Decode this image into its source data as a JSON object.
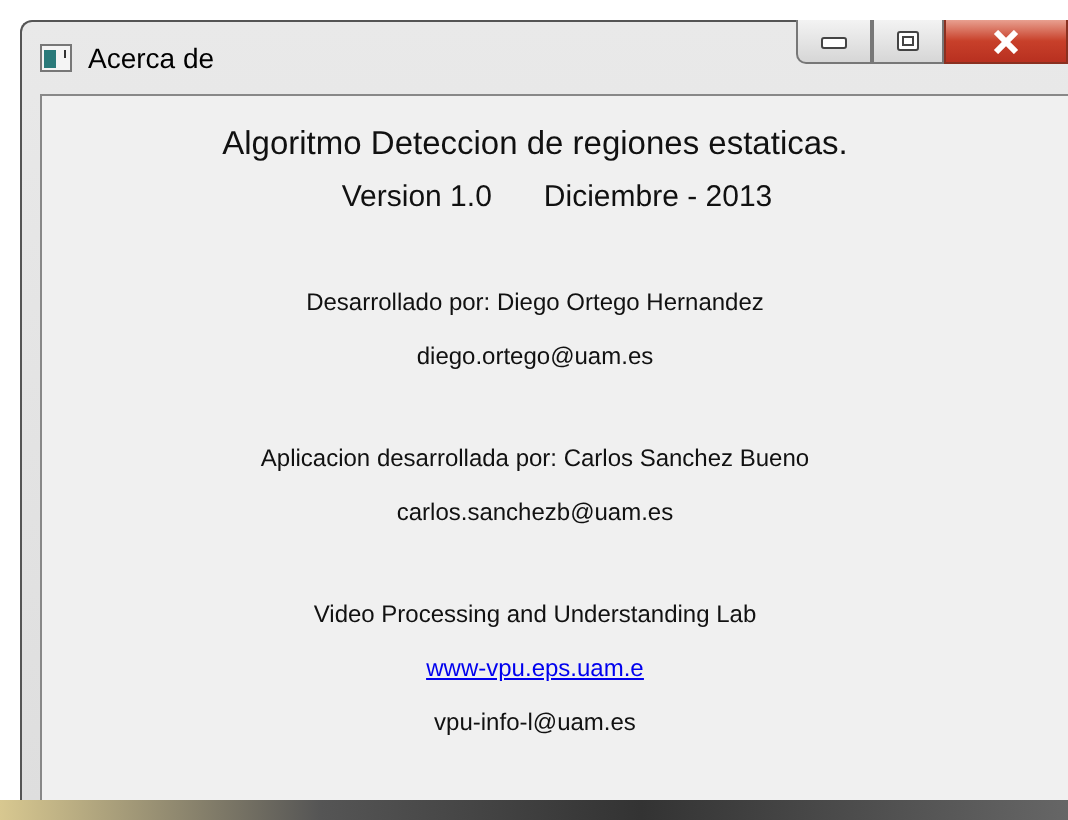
{
  "window": {
    "title": "Acerca de",
    "controls": [
      {
        "kind": "minimize"
      },
      {
        "kind": "maximize"
      },
      {
        "kind": "close"
      }
    ]
  },
  "sections": [
    {
      "lines": [
        {
          "kind": "heading",
          "parts": [
            "Algoritmo Deteccion de regiones estaticas."
          ]
        },
        {
          "kind": "subheading",
          "parts": [
            "Version 1.0",
            "Diciembre - 2013"
          ]
        }
      ]
    },
    {
      "lines": [
        {
          "kind": "text",
          "parts": [
            "Desarrollado por: Diego Ortego Hernandez"
          ]
        },
        {
          "kind": "text",
          "parts": [
            "diego.ortego@uam.es"
          ]
        }
      ]
    },
    {
      "lines": [
        {
          "kind": "text",
          "parts": [
            "Aplicacion desarrollada por: Carlos Sanchez Bueno"
          ]
        },
        {
          "kind": "text",
          "parts": [
            "carlos.sanchezb@uam.es"
          ]
        }
      ]
    },
    {
      "lines": [
        {
          "kind": "text",
          "parts": [
            "Video Processing and Understanding Lab"
          ]
        },
        {
          "kind": "link",
          "parts": [
            "www-vpu.eps.uam.e"
          ]
        },
        {
          "kind": "text",
          "parts": [
            "vpu-info-l@uam.es"
          ]
        }
      ]
    }
  ]
}
